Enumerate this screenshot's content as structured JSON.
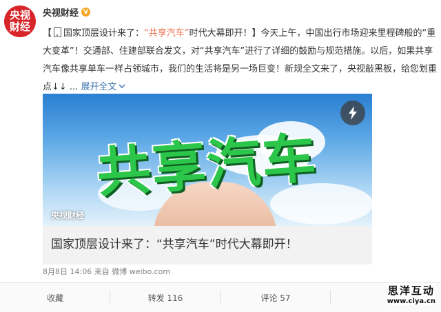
{
  "author": {
    "avatar_line1": "央视",
    "avatar_line2": "财经",
    "name": "央视财经",
    "verified_badge": "V"
  },
  "post": {
    "bracket_open": "【",
    "text_a": "国家顶层设计来了：",
    "highlight": "“共享汽车”",
    "text_b": "时代大幕即开！】今天上午，中国出行市场迎来里程碑般的“重大变革”！交通部、住建部联合发文，对“共享汽车”进行了详细的鼓励与规范措施。以后，如果共享汽车像共享单车一样占领城市，我们的生活将是另一场巨变！新规全文来了，央视敲黑板，给您划重点↓↓ ...",
    "expand_label": "展开全文",
    "expand_icon": "chevron-down-icon"
  },
  "media": {
    "image_title": "共享汽车",
    "image_source_label": "央视财经",
    "caption": "国家顶层设计来了：“共享汽车”时代大幕即开！",
    "bolt_icon": "lightning-icon"
  },
  "meta": {
    "time": "8月8日 14:06",
    "from": "来自",
    "source": "微博 weibo.com"
  },
  "actions": {
    "favorite": "收藏",
    "repost": "转发 116",
    "comment": "评论 57",
    "like": ""
  },
  "watermark": {
    "name": "思洋互动",
    "url": "www.ciya.cn"
  },
  "colors": {
    "accent": "#eb7350",
    "link": "#3b76b0",
    "avatar_bg": "#d7252a",
    "title_green": "#2cc64a"
  }
}
